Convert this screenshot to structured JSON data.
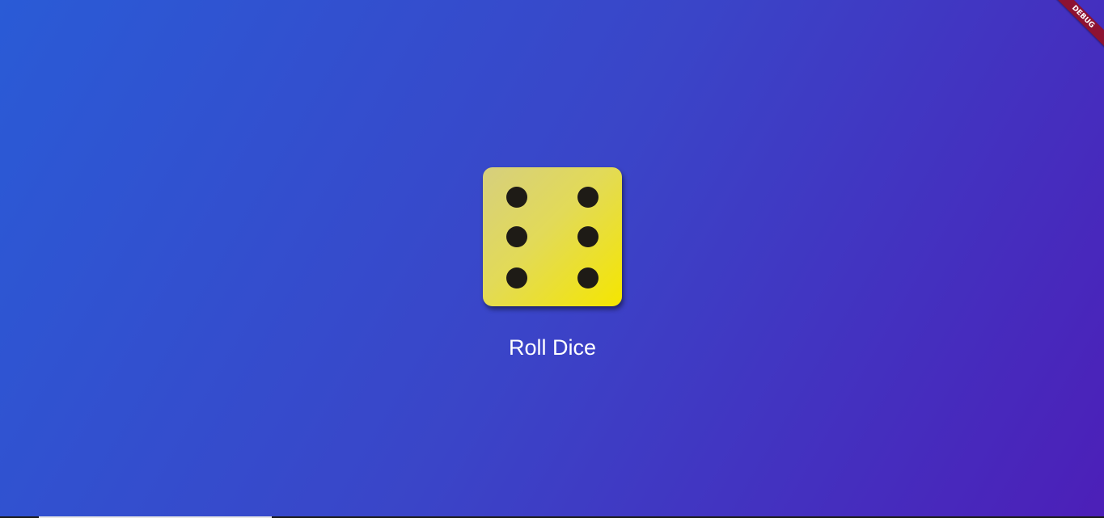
{
  "app": {
    "roll_button_label": "Roll Dice",
    "debug_banner_label": "DEBUG"
  },
  "dice": {
    "face_value": 6,
    "pip_color": "#1e1b16",
    "face_colors": [
      "#d6cf7e",
      "#f5e600"
    ]
  },
  "colors": {
    "background_start": "#2a5bd6",
    "background_end": "#4c1fb8",
    "text": "#ffffff",
    "debug_banner": "#8d1232"
  }
}
